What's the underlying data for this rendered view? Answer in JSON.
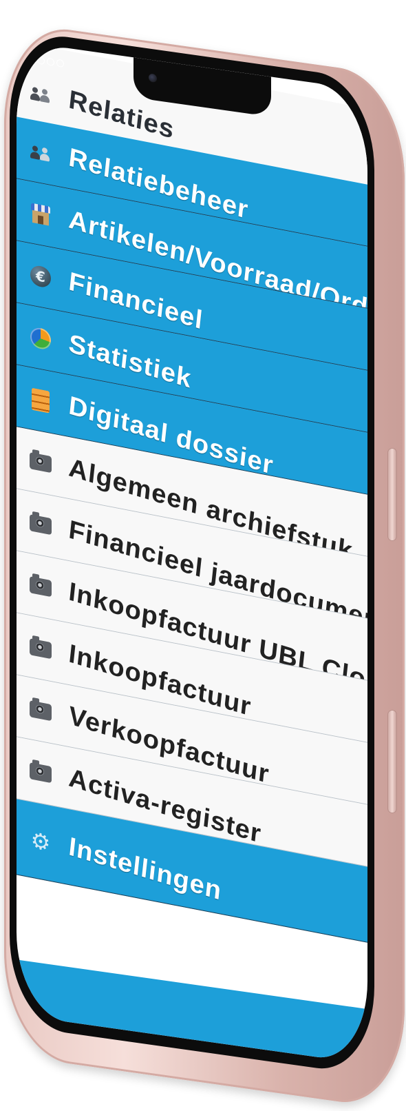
{
  "status_bar": {
    "dots": 4,
    "filled": 1
  },
  "menu": {
    "header": {
      "label": "Relaties",
      "icon": "people-icon"
    },
    "blue_items": [
      {
        "label": "Relatiebeheer",
        "icon": "people-icon"
      },
      {
        "label": "Artikelen/Voorraad/Orde",
        "icon": "shop-icon"
      },
      {
        "label": "Financieel",
        "icon": "euro-icon"
      },
      {
        "label": "Statistiek",
        "icon": "pie-chart-icon"
      },
      {
        "label": "Digitaal dossier",
        "icon": "archive-icon"
      }
    ],
    "dossier_items": [
      {
        "label": "Algemeen archiefstuk",
        "icon": "camera-icon"
      },
      {
        "label": "Financieel jaardocumen",
        "icon": "camera-icon"
      },
      {
        "label": "Inkoopfactuur UBL Clou",
        "icon": "camera-icon"
      },
      {
        "label": "Inkoopfactuur",
        "icon": "camera-icon"
      },
      {
        "label": "Verkoopfactuur",
        "icon": "camera-icon"
      },
      {
        "label": "Activa-register",
        "icon": "camera-icon"
      }
    ],
    "footer": {
      "label": "Instellingen",
      "icon": "gear-icon"
    }
  },
  "colors": {
    "accent_blue": "#1d9fd9",
    "row_white": "#f8f8f8",
    "phone_frame": "#e9c9c3"
  }
}
